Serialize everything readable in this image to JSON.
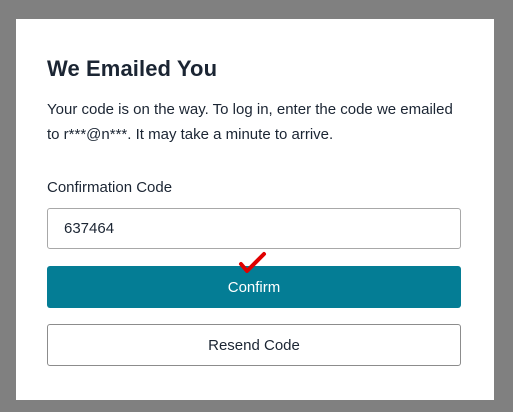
{
  "dialog": {
    "title": "We Emailed You",
    "description": "Your code is on the way. To log in, enter the code we emailed to r***@n***. It may take a minute to arrive.",
    "code_label": "Confirmation Code",
    "code_value": "637464",
    "confirm_label": "Confirm",
    "resend_label": "Resend Code"
  },
  "colors": {
    "backdrop": "#808080",
    "primary_button": "#047d95",
    "check_mark": "#e00000"
  },
  "icons": {
    "annotation": "red-check-mark-icon"
  }
}
